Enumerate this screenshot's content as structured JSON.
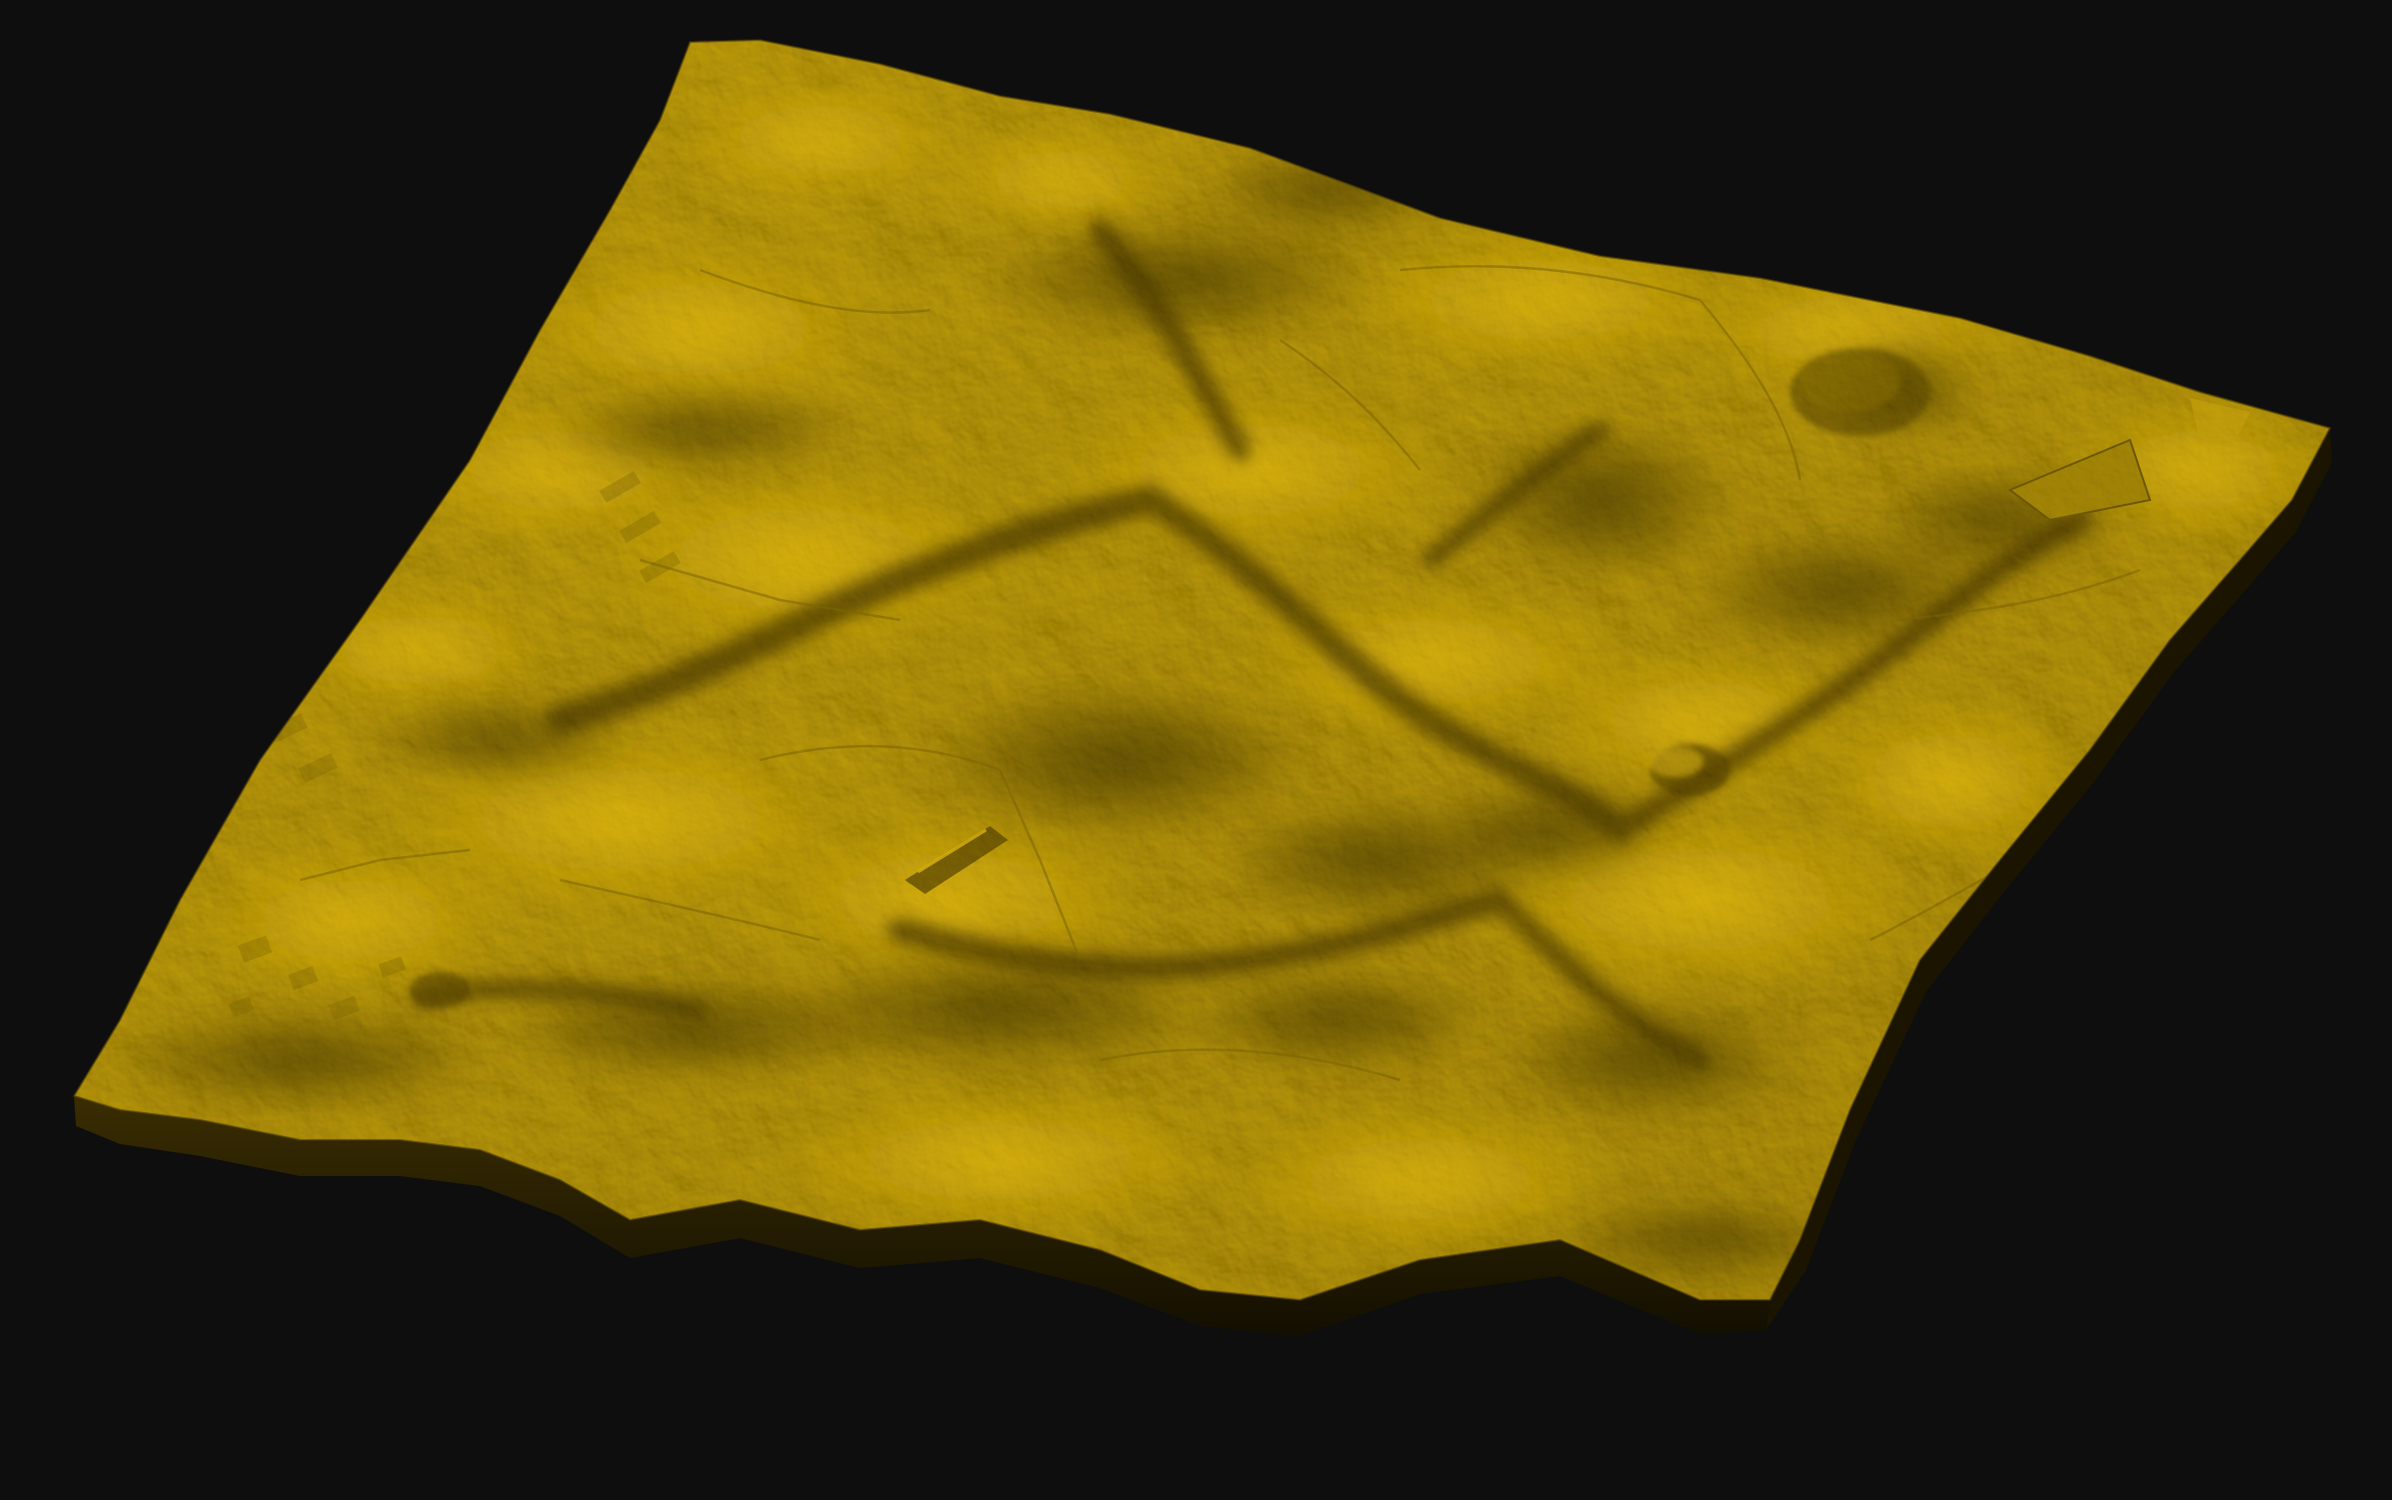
{
  "scene": {
    "subject": "shaded-relief-terrain-model",
    "colors": {
      "background": "#0e0e0f",
      "terrain_base": "#a88a06",
      "terrain_highlight": "#e0b80e",
      "terrain_mid": "#8c7004",
      "terrain_shadow": "#3a2d02",
      "edge_side": "#1c1601"
    }
  }
}
